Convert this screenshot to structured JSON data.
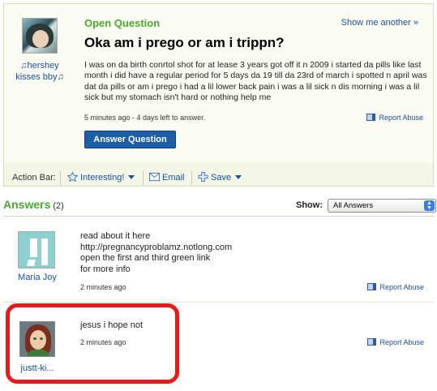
{
  "question": {
    "label": "Open Question",
    "show_another": "Show me another »",
    "title": "Oka am i prego or am i trippn?",
    "body": "I was on da birth conrtol shot for at lease 3 years got off it n 2009 i started da pills like last month i did have a regular period for 5 days da 19 till da 23rd of march i spotted n april was dat da pills or am i prego i had a lil lower back pain i was a lil sick n dis morning i was a lil sick but my stomach isn't hard or nothing help me",
    "meta": "5 minutes ago - 4 days left to answer.",
    "report_abuse": "Report Abuse",
    "answer_button": "Answer Question",
    "asker": {
      "name": "♫hershey kisses bby♫",
      "avatar_icon": "asker-avatar-image"
    }
  },
  "action_bar": {
    "label": "Action Bar:",
    "interesting": "Interesting!",
    "email": "Email",
    "save": "Save"
  },
  "answers": {
    "heading": "Answers",
    "count": "(2)",
    "show_label": "Show:",
    "filter_selected": "All Answers",
    "items": [
      {
        "user": "Maria Joy",
        "lines": [
          "read about it here",
          "http://pregnancyproblamz.notlong.com",
          "open the first and third green link",
          "for more info"
        ],
        "meta": "2 minutes ago",
        "report_abuse": "Report Abuse"
      },
      {
        "user": "justt-ki...",
        "lines": [
          "jesus i hope not"
        ],
        "meta": "2 minutes ago",
        "report_abuse": "Report Abuse"
      }
    ]
  },
  "colors": {
    "green_heading": "#48a92a",
    "link_blue": "#1a4f9c",
    "button_blue": "#1d5ea8",
    "highlight_red": "#e51b1b"
  }
}
